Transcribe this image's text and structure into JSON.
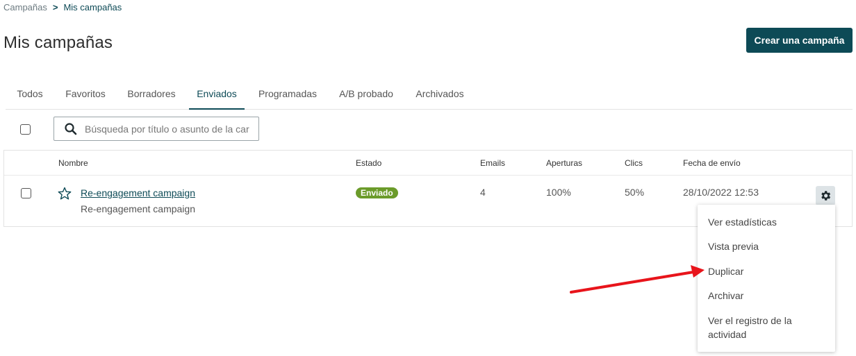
{
  "breadcrumb": {
    "parent": "Campañas",
    "separator": ">",
    "current": "Mis campañas"
  },
  "page_title": "Mis campañas",
  "create_button": "Crear una campaña",
  "tabs": [
    "Todos",
    "Favoritos",
    "Borradores",
    "Enviados",
    "Programadas",
    "A/B probado",
    "Archivados"
  ],
  "active_tab": "Enviados",
  "search": {
    "placeholder": "Búsqueda por título o asunto de la car",
    "value": ""
  },
  "table": {
    "headers": {
      "name": "Nombre",
      "status": "Estado",
      "emails": "Emails",
      "opens": "Aperturas",
      "clicks": "Clics",
      "sent_date": "Fecha de envío"
    },
    "rows": [
      {
        "title": "Re-engagement campaign",
        "subject": "Re-engagement campaign",
        "status": "Enviado",
        "emails": "4",
        "opens": "100%",
        "clicks": "50%",
        "sent_date": "28/10/2022 12:53"
      }
    ]
  },
  "actions_menu": {
    "items": [
      "Ver estadísticas",
      "Vista previa",
      "Duplicar",
      "Archivar",
      "Ver el registro de la actividad"
    ]
  },
  "colors": {
    "primary": "#0d4a56",
    "status_sent": "#6b9b2a",
    "annotation_arrow": "#e8141b",
    "gear_bg": "#dde3e6"
  },
  "icons": {
    "search": "search-icon",
    "star": "star-outline-icon",
    "gear": "gear-icon",
    "breadcrumb_separator": "chevron-right-icon"
  }
}
